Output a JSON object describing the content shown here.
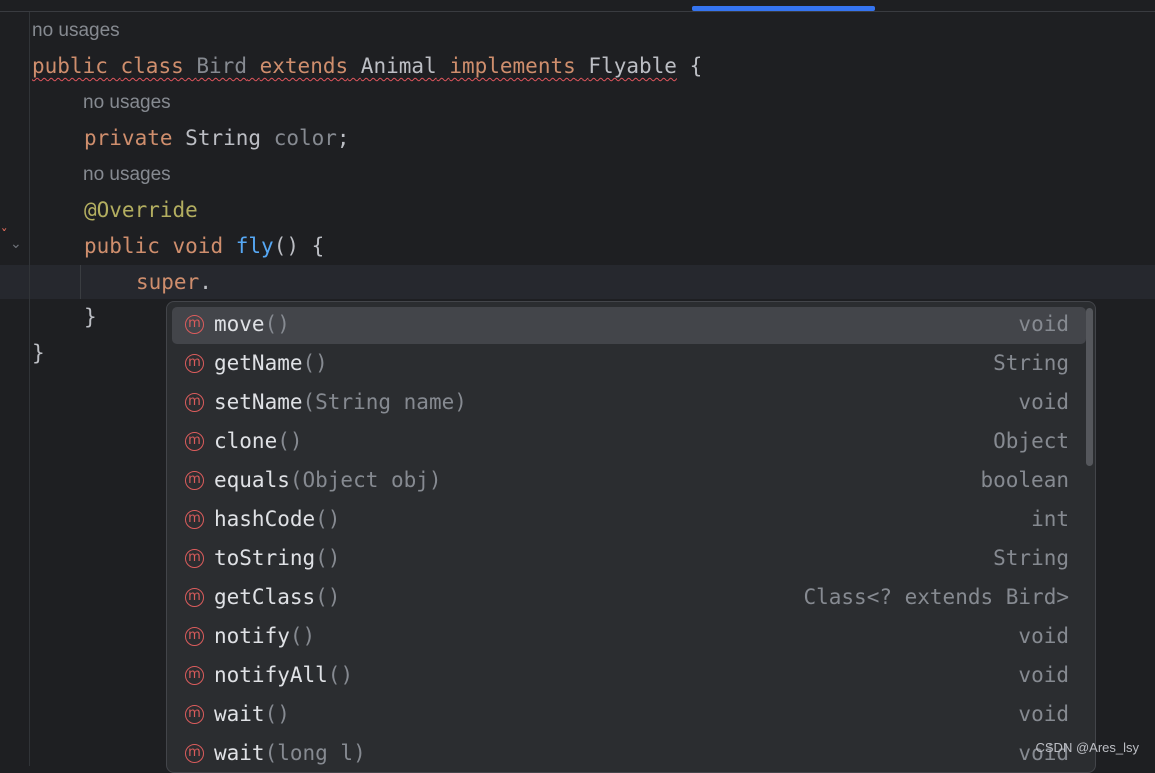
{
  "code": {
    "usage_hint": "no usages",
    "class_line": {
      "kw_public": "public",
      "kw_class": "class",
      "class_name": "Bird",
      "kw_extends": "extends",
      "parent": "Animal",
      "kw_implements": "implements",
      "iface": "Flyable",
      "brace": "{"
    },
    "field_line": {
      "kw_private": "private",
      "type": "String",
      "name": "color",
      "semi": ";"
    },
    "annotation": "@Override",
    "method_line": {
      "kw_public": "public",
      "kw_void": "void",
      "name": "fly",
      "rest": "() {"
    },
    "typed_line": {
      "kw_super": "super",
      "dot": "."
    },
    "close_inner": "}",
    "close_outer": "}"
  },
  "completion": {
    "items": [
      {
        "icon": "method-icon",
        "name": "move",
        "params": "()",
        "type": "void"
      },
      {
        "icon": "method-icon",
        "name": "getName",
        "params": "()",
        "type": "String"
      },
      {
        "icon": "method-icon",
        "name": "setName",
        "params": "(String name)",
        "type": "void"
      },
      {
        "icon": "method-icon",
        "name": "clone",
        "params": "()",
        "type": "Object"
      },
      {
        "icon": "method-icon",
        "name": "equals",
        "params": "(Object obj)",
        "type": "boolean"
      },
      {
        "icon": "method-icon",
        "name": "hashCode",
        "params": "()",
        "type": "int"
      },
      {
        "icon": "method-icon",
        "name": "toString",
        "params": "()",
        "type": "String"
      },
      {
        "icon": "method-icon",
        "name": "getClass",
        "params": "()",
        "type": "Class<? extends Bird>"
      },
      {
        "icon": "method-icon",
        "name": "notify",
        "params": "()",
        "type": "void"
      },
      {
        "icon": "method-icon",
        "name": "notifyAll",
        "params": "()",
        "type": "void"
      },
      {
        "icon": "method-icon",
        "name": "wait",
        "params": "()",
        "type": "void"
      },
      {
        "icon": "method-icon",
        "name": "wait",
        "params": "(long l)",
        "type": "void"
      }
    ],
    "icon_letter": "m",
    "selected_index": 0
  },
  "watermark": "CSDN @Ares_lsy",
  "colors": {
    "keyword": "#cf8e6d",
    "function": "#56a8f5",
    "annotation": "#b3ae60",
    "accent": "#3574f0",
    "method_icon": "#db5c5c"
  }
}
